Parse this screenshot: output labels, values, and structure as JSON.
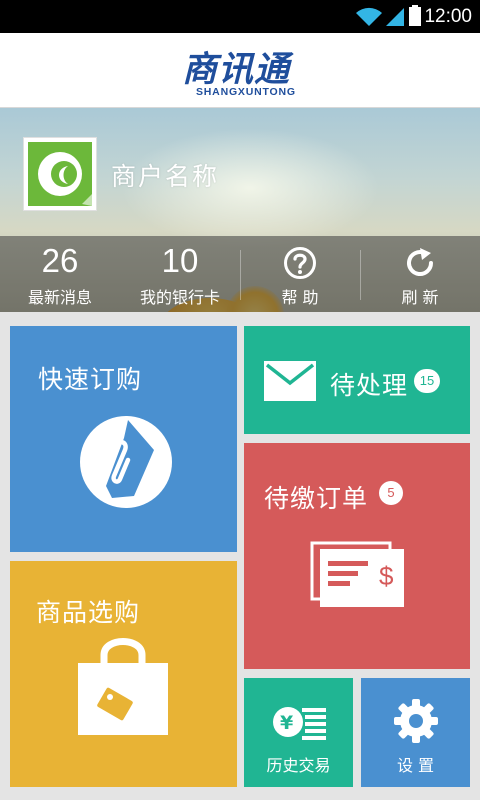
{
  "status_bar": {
    "time": "12:00"
  },
  "app": {
    "logo_cn": "商讯通",
    "logo_en": "SHANGXUNTONG"
  },
  "merchant": {
    "name": "商户名称"
  },
  "stats": [
    {
      "value": "26",
      "label": "最新消息"
    },
    {
      "value": "10",
      "label": "我的银行卡"
    },
    {
      "label": "帮 助",
      "icon": "help-circle-icon"
    },
    {
      "label": "刷 新",
      "icon": "refresh-icon"
    }
  ],
  "tiles": {
    "quick_order": {
      "label": "快速订购",
      "color": "#4a90d0",
      "icon": "paperclip-icon"
    },
    "pending": {
      "label": "待处理",
      "badge": "15",
      "color": "#20b593",
      "icon": "envelope-icon"
    },
    "unpaid_orders": {
      "label": "待缴订单",
      "badge": "5",
      "color": "#d55a5a",
      "icon": "invoice-dollar-icon"
    },
    "product_shopping": {
      "label": "商品选购",
      "color": "#e8b335",
      "icon": "shopping-bag-icon"
    },
    "history": {
      "label": "历史交易",
      "color": "#20b593",
      "icon": "yen-coins-icon"
    },
    "settings": {
      "label": "设 置",
      "color": "#4a90d0",
      "icon": "gear-icon"
    }
  }
}
